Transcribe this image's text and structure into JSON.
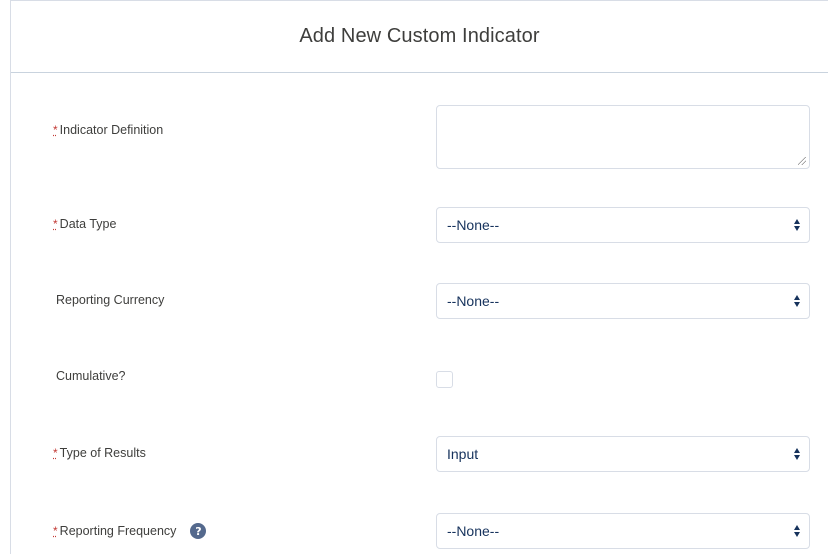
{
  "modal": {
    "title": "Add New Custom Indicator"
  },
  "form": {
    "indicator_definition": {
      "required_mark": "*",
      "label": "Indicator Definition",
      "value": ""
    },
    "data_type": {
      "required_mark": "*",
      "label": "Data Type",
      "value": "--None--"
    },
    "reporting_currency": {
      "label": "Reporting Currency",
      "value": "--None--"
    },
    "cumulative": {
      "label": "Cumulative?",
      "checked": false
    },
    "type_of_results": {
      "required_mark": "*",
      "label": "Type of Results",
      "value": "Input"
    },
    "reporting_frequency": {
      "required_mark": "*",
      "label": "Reporting Frequency",
      "help_icon": "question-circle-icon",
      "help_glyph": "?",
      "value": "--None--"
    }
  },
  "colors": {
    "required": "#c23934",
    "text": "#3e3e3c",
    "select_text": "#16325c",
    "border": "#d8dde6",
    "help_icon_bg": "#54698d"
  }
}
